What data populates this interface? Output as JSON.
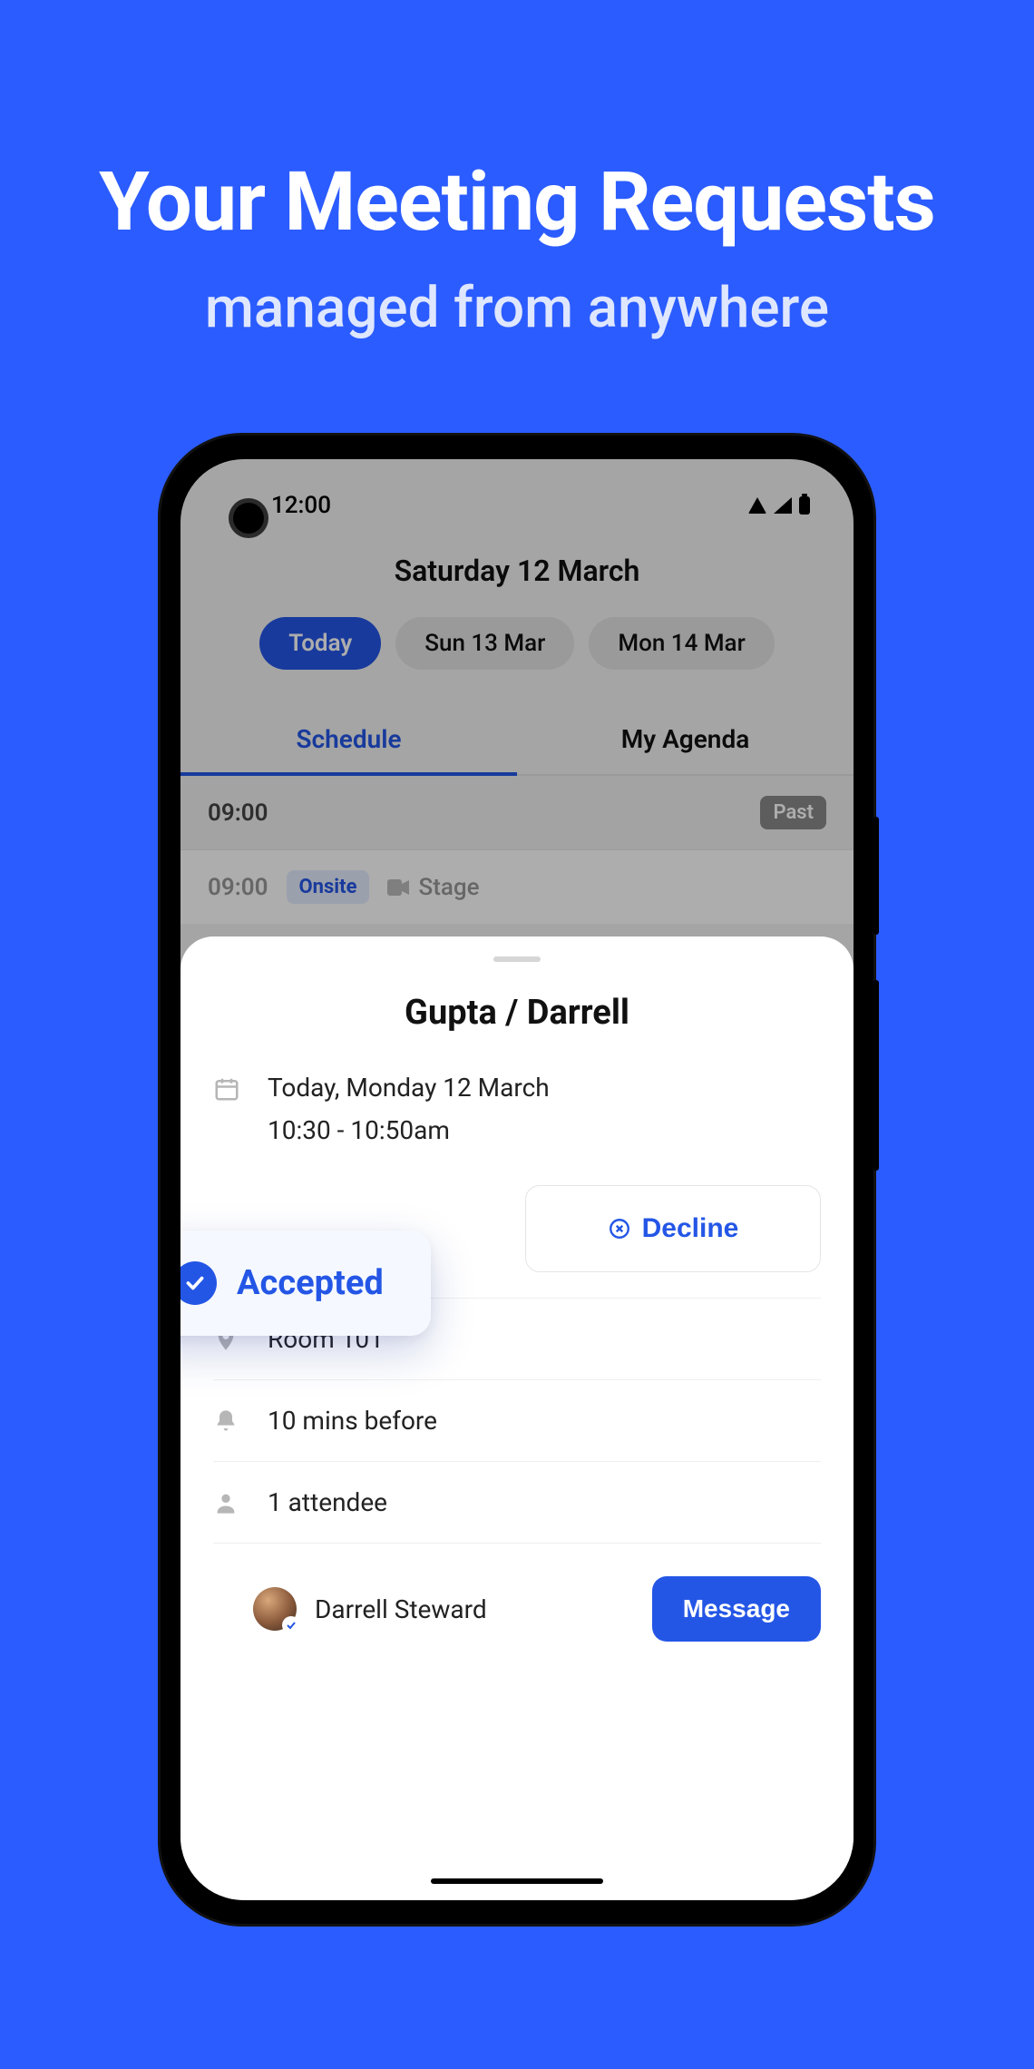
{
  "promo": {
    "title": "Your Meeting Requests",
    "subtitle": "managed from anywhere"
  },
  "statusbar": {
    "time": "12:00"
  },
  "header": {
    "date": "Saturday 12 March",
    "chips": [
      {
        "label": "Today",
        "active": true
      },
      {
        "label": "Sun 13 Mar",
        "active": false
      },
      {
        "label": "Mon 14 Mar",
        "active": false
      }
    ],
    "tabs": [
      {
        "label": "Schedule",
        "active": true
      },
      {
        "label": "My Agenda",
        "active": false
      }
    ]
  },
  "timeline": {
    "slot1": {
      "time": "09:00",
      "badge": "Past"
    },
    "slot2": {
      "time": "09:00",
      "tag": "Onsite",
      "stage": "Stage"
    }
  },
  "sheet": {
    "title": "Gupta / Darrell",
    "date_line": "Today, Monday 12 March",
    "time_line": "10:30 - 10:50am",
    "accepted": "Accepted",
    "decline": "Decline",
    "location": "Room 101",
    "reminder": "10 mins before",
    "attendees_label": "1 attendee",
    "attendee_name": "Darrell Steward",
    "message_btn": "Message"
  }
}
